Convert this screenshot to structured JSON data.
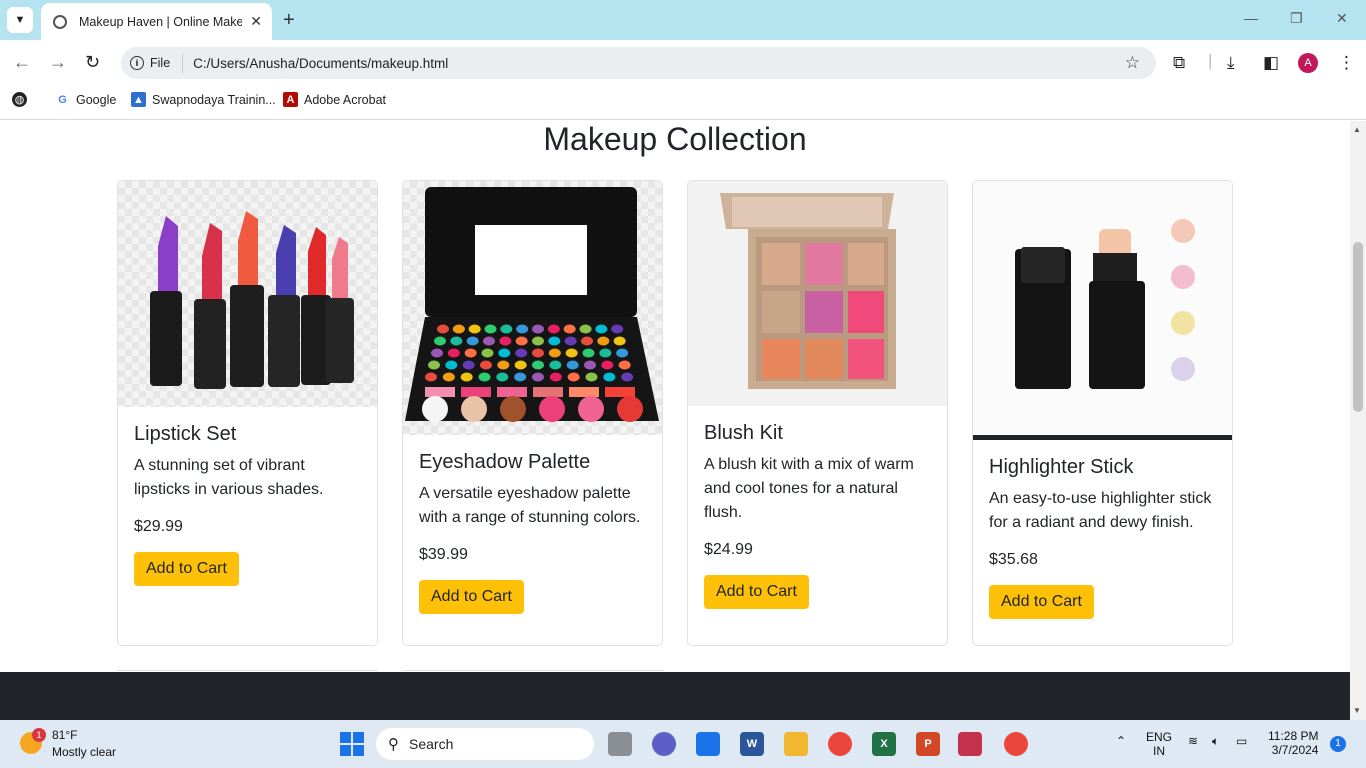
{
  "browser": {
    "tab_title": "Makeup Haven | Online Makeup",
    "tab_dropdown_icon": "chevron-down-icon",
    "new_tab_label": "+",
    "omnibox_chip": "File",
    "url": "C:/Users/Anusha/Documents/makeup.html",
    "profile_initial": "A",
    "bookmarks": [
      {
        "label": "Google",
        "icon": "google-icon"
      },
      {
        "label": "Swapnodaya Trainin...",
        "icon": "profile-bookmark-icon"
      },
      {
        "label": "Adobe Acrobat",
        "icon": "acrobat-icon"
      }
    ]
  },
  "page": {
    "title": "Makeup Collection",
    "products": [
      {
        "name": "Lipstick Set",
        "description": "A stunning set of vibrant lipsticks in various shades.",
        "price": "$29.99",
        "button": "Add to Cart"
      },
      {
        "name": "Eyeshadow Palette",
        "description": "A versatile eyeshadow palette with a range of stunning colors.",
        "price": "$39.99",
        "button": "Add to Cart"
      },
      {
        "name": "Blush Kit",
        "description": "A blush kit with a mix of warm and cool tones for a natural flush.",
        "price": "$24.99",
        "button": "Add to Cart"
      },
      {
        "name": "Highlighter Stick",
        "description": "An easy-to-use highlighter stick for a radiant and dewy finish.",
        "price": "$35.68",
        "button": "Add to Cart"
      }
    ],
    "colors": {
      "button_bg": "#ffc107",
      "footer_bg": "#212529"
    }
  },
  "taskbar": {
    "weather_temp": "81°F",
    "weather_desc": "Mostly clear",
    "weather_badge": "1",
    "search_label": "Search",
    "lang_top": "ENG",
    "lang_bottom": "IN",
    "time": "11:28 PM",
    "date": "3/7/2024",
    "notification_count": "1"
  }
}
